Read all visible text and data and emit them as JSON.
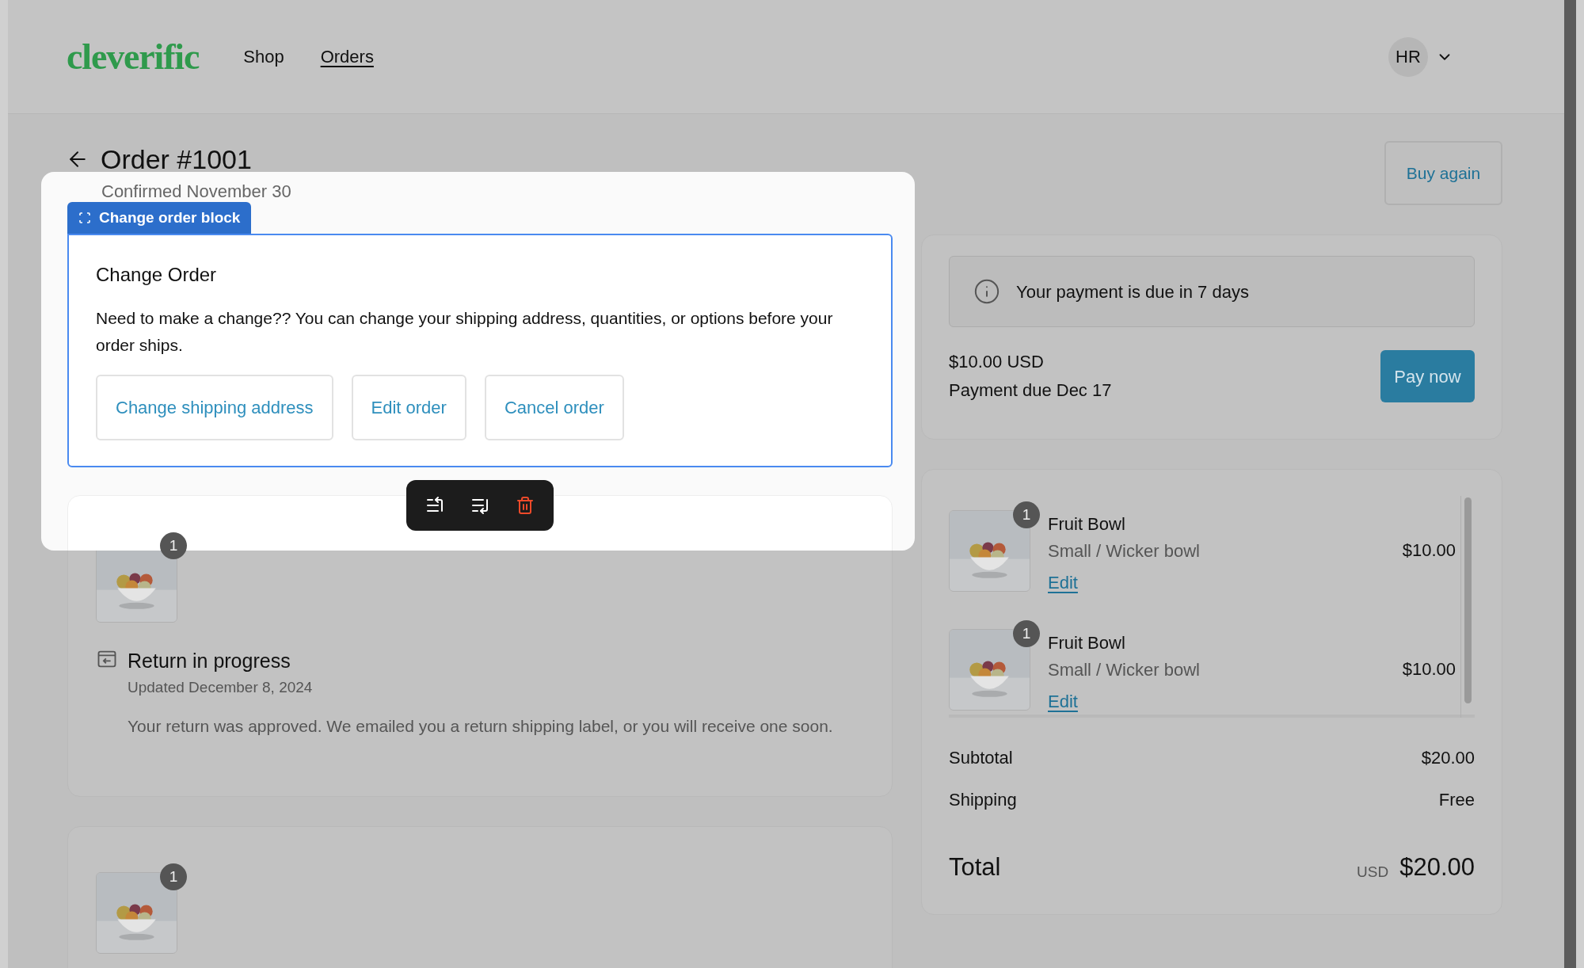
{
  "header": {
    "logo": "cleverific",
    "nav": [
      {
        "label": "Shop",
        "selected": false
      },
      {
        "label": "Orders",
        "selected": true
      }
    ],
    "account": {
      "initials": "HR"
    }
  },
  "order": {
    "title": "Order #1001",
    "subtitle": "Confirmed November 30",
    "buy_again": "Buy again"
  },
  "editor": {
    "block_label": "Change order block",
    "heading": "Change Order",
    "text": "Need to make a change?? You can change your shipping address, quantities, or options before your order ships.",
    "buttons": [
      "Change shipping address",
      "Edit order",
      "Cancel order"
    ]
  },
  "fulfillments": [
    {
      "quantity": "1",
      "status": "Return in progress",
      "updated": "Updated December 8, 2024",
      "message": "Your return was approved. We emailed you a return shipping label, or you will receive one soon."
    },
    {
      "quantity": "1"
    }
  ],
  "payment": {
    "notice": "Your payment is due in 7 days",
    "amount": "$10.00 USD",
    "due": "Payment due Dec 17",
    "button": "Pay now"
  },
  "items": [
    {
      "quantity": "1",
      "name": "Fruit Bowl",
      "variant": "Small / Wicker bowl",
      "edit": "Edit",
      "price": "$10.00"
    },
    {
      "quantity": "1",
      "name": "Fruit Bowl",
      "variant": "Small / Wicker bowl",
      "edit": "Edit",
      "price": "$10.00"
    }
  ],
  "summary": {
    "rows": [
      {
        "label": "Subtotal",
        "value": "$20.00"
      },
      {
        "label": "Shipping",
        "value": "Free"
      }
    ],
    "total": {
      "label": "Total",
      "currency": "USD",
      "value": "$20.00"
    }
  }
}
